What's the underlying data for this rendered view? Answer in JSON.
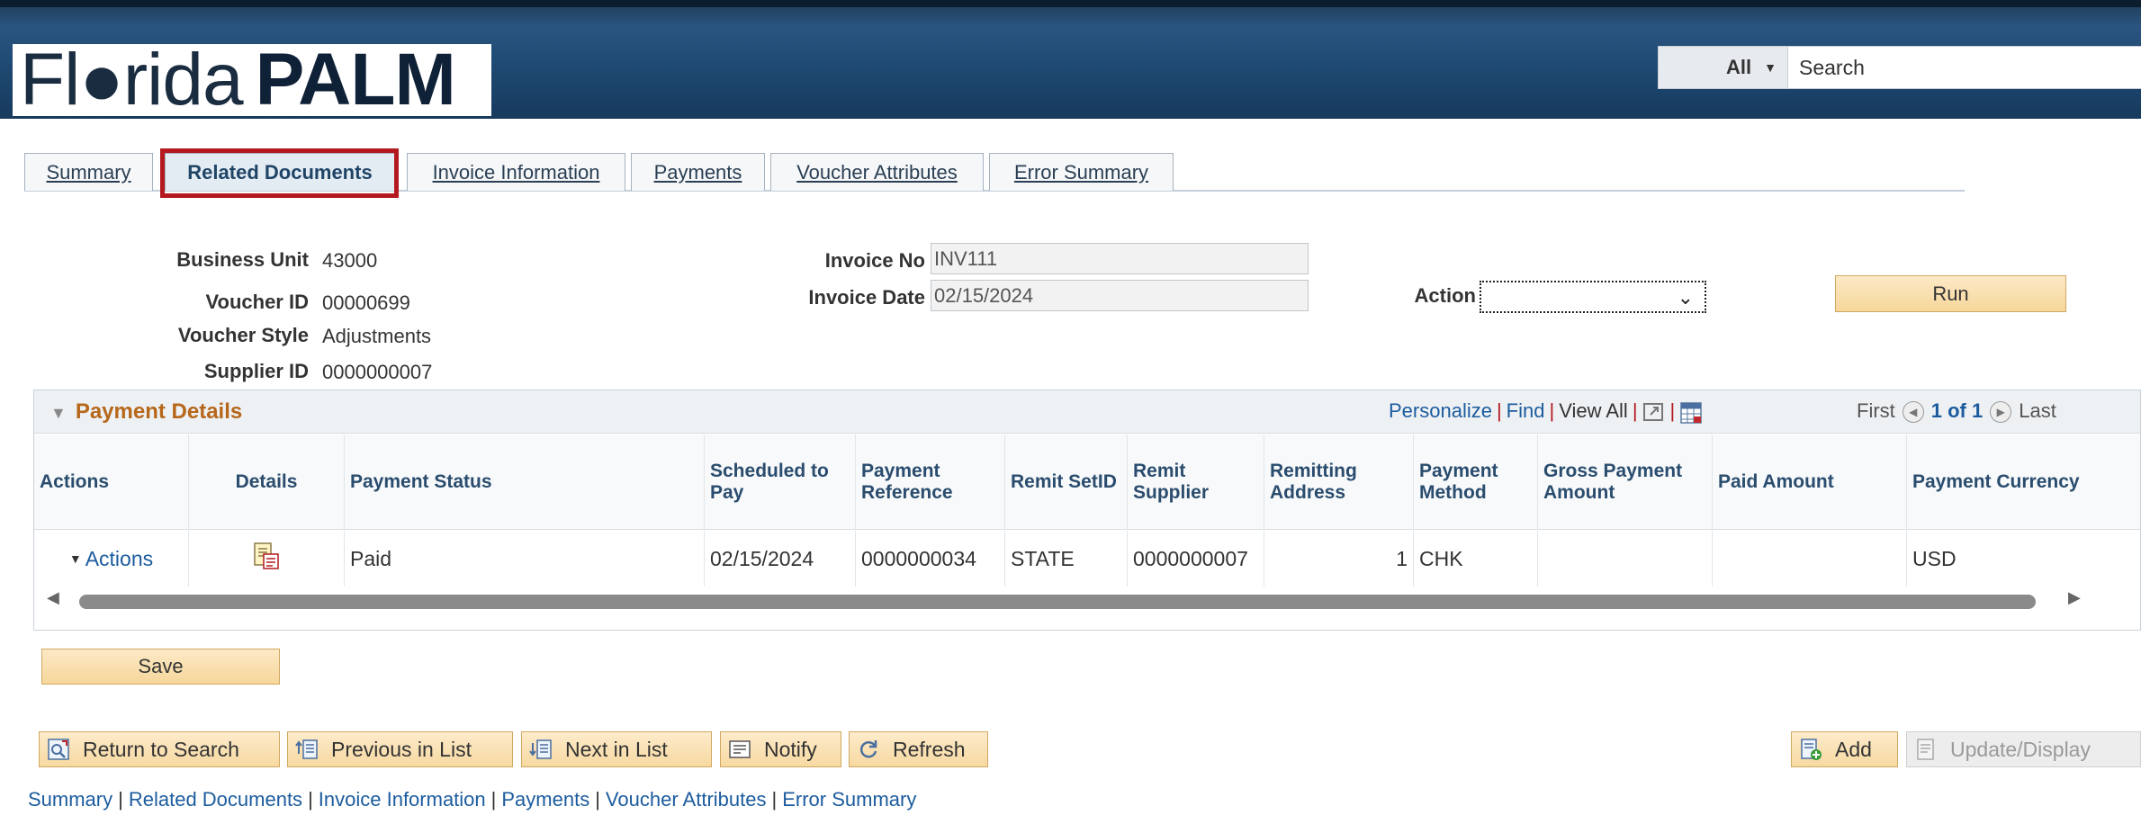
{
  "header": {
    "logo_light": "Fl●rida",
    "logo_bold": "PALM",
    "search_scope": "All",
    "search_placeholder": "Search"
  },
  "tabs": [
    {
      "label": "Summary"
    },
    {
      "label": "Related Documents"
    },
    {
      "label": "Invoice Information"
    },
    {
      "label": "Payments"
    },
    {
      "label": "Voucher Attributes"
    },
    {
      "label": "Error Summary"
    }
  ],
  "form": {
    "business_unit_label": "Business Unit",
    "business_unit": "43000",
    "voucher_id_label": "Voucher ID",
    "voucher_id": "00000699",
    "voucher_style_label": "Voucher Style",
    "voucher_style": "Adjustments",
    "supplier_id_label": "Supplier ID",
    "supplier_id": "0000000007",
    "invoice_no_label": "Invoice No",
    "invoice_no": "INV111",
    "invoice_date_label": "Invoice Date",
    "invoice_date": "02/15/2024",
    "action_label": "Action",
    "action_value": "",
    "run_label": "Run"
  },
  "grid": {
    "title": "Payment Details",
    "personalize": "Personalize",
    "find": "Find",
    "view_all": "View All",
    "first": "First",
    "count": "1 of 1",
    "last": "Last",
    "columns": [
      "Actions",
      "Details",
      "Payment Status",
      "Scheduled to Pay",
      "Payment Reference",
      "Remit SetID",
      "Remit Supplier",
      "Remitting Address",
      "Payment Method",
      "Gross Payment Amount",
      "Paid Amount",
      "Payment Currency"
    ],
    "row": {
      "actions": "Actions",
      "payment_status": "Paid",
      "scheduled_to_pay": "02/15/2024",
      "payment_reference": "0000000034",
      "remit_setid": "STATE",
      "remit_supplier": "0000000007",
      "remitting_address": "1",
      "payment_method": "CHK",
      "gross_payment_amount": "",
      "paid_amount": "",
      "payment_currency": "USD"
    }
  },
  "buttons": {
    "save": "Save",
    "return_to_search": "Return to Search",
    "previous_in_list": "Previous in List",
    "next_in_list": "Next in List",
    "notify": "Notify",
    "refresh": "Refresh",
    "add": "Add",
    "update_display": "Update/Display"
  },
  "footer_links": [
    "Summary",
    "Related Documents",
    "Invoice Information",
    "Payments",
    "Voucher Attributes",
    "Error Summary"
  ],
  "colors": {
    "header_blue": "#1f4a73",
    "highlight_red": "#b3191f",
    "link_blue": "#1c5c9e",
    "grid_title_orange": "#b6671a",
    "button_peach": "#f6d79b"
  }
}
